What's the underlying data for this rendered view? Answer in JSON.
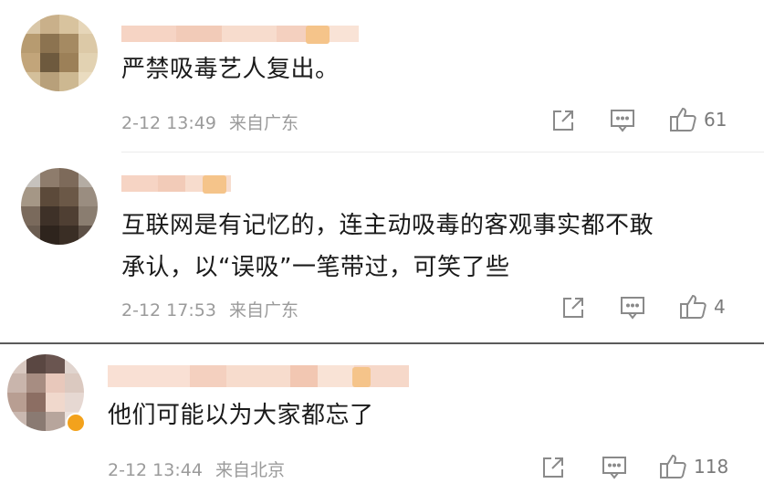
{
  "comments": [
    {
      "text_lines": [
        "严禁吸毒艺人复出。"
      ],
      "time": "2-12 13:49",
      "location": "来自广东",
      "likes": "61"
    },
    {
      "text_lines": [
        "互联网是有记忆的，连主动吸毒的客观事实都不敢",
        "承认，以“误吸”一笔带过，可笑了些"
      ],
      "time": "2-12 17:53",
      "location": "来自广东",
      "likes": "4"
    },
    {
      "text_lines": [
        "他们可能以为大家都忘了"
      ],
      "time": "2-12 13:44",
      "location": "来自北京",
      "likes": "118"
    }
  ],
  "icons": {
    "share": "share-icon",
    "comment": "comment-icon",
    "like": "thumbs-up-icon"
  },
  "colors": {
    "text": "#1a1a1a",
    "meta": "#9b9b9b",
    "icon": "#8a8a8a",
    "divider": "#ececec",
    "badge": "#f3a21c"
  }
}
